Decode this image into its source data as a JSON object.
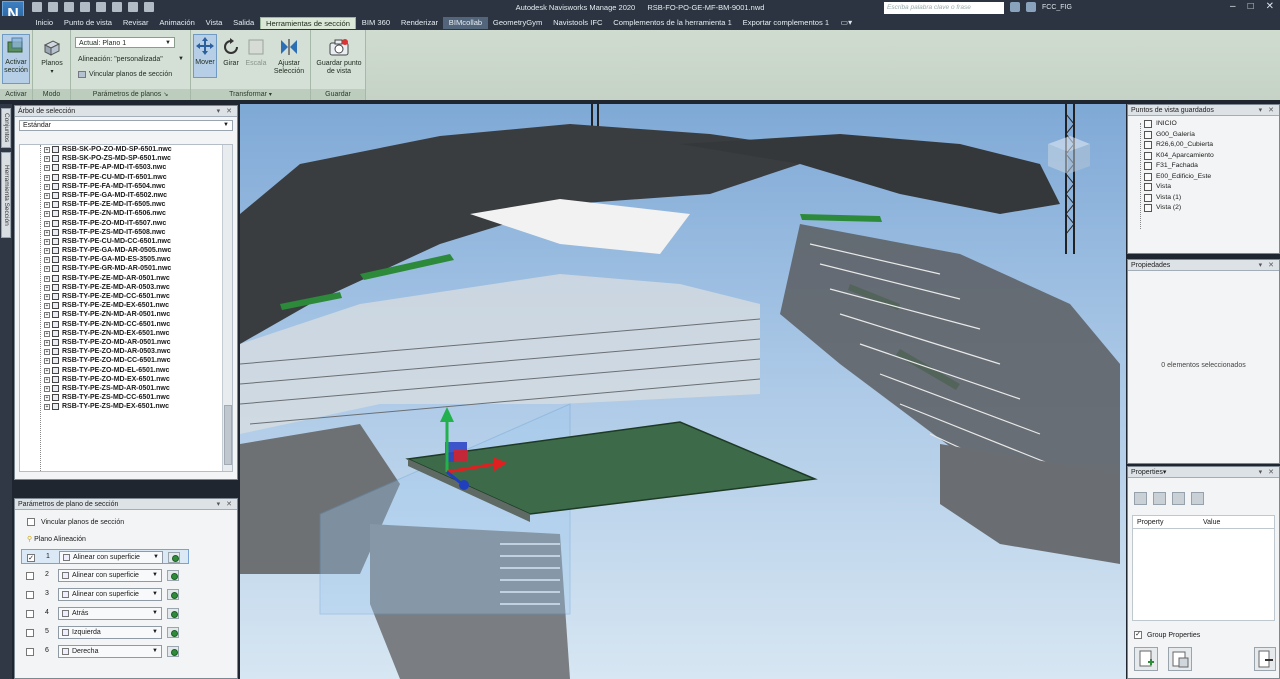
{
  "title": {
    "app": "Autodesk Navisworks Manage 2020",
    "file": "RSB-FO-PO-GE-MF-BM-9001.nwd",
    "search_placeholder": "Escriba palabra clave o frase",
    "user": "FCC_FIG"
  },
  "menu": {
    "tabs": [
      "Inicio",
      "Punto de vista",
      "Revisar",
      "Animación",
      "Vista",
      "Salida",
      "Herramientas de sección",
      "BIM 360",
      "Renderizar",
      "BIMcollab",
      "GeometryGym",
      "Navistools IFC",
      "Complementos de la herramienta 1",
      "Exportar complementos 1"
    ],
    "active_index": 6,
    "hover_index": 9
  },
  "ribbon": {
    "activar": {
      "button": "Activar sección",
      "label": "Activar"
    },
    "modo": {
      "button": "Planos",
      "label": "Modo"
    },
    "parametros": {
      "current_plane": "Actual: Plano 1",
      "alignment": "Alineación: \"personalizada\"",
      "link": "Vincular planos de sección",
      "label": "Parámetros de planos"
    },
    "transformar": {
      "mover": "Mover",
      "girar": "Girar",
      "escala": "Escala",
      "ajustar": "Ajustar Selección",
      "label": "Transformar"
    },
    "guardar": {
      "button": "Guardar punto de vista",
      "label": "Guardar"
    }
  },
  "side_tabs": [
    "Conjuntos",
    "Herramienta Sección"
  ],
  "selection_tree": {
    "title": "Árbol de selección",
    "mode": "Estándar",
    "items": [
      "RSB-SK-PO-ZO-MD-SP-6501.nwc",
      "RSB-SK-PO-ZS-MD-SP-6501.nwc",
      "RSB-TF-PE-AP-MD-IT-6503.nwc",
      "RSB-TF-PE-CU-MD-IT-6501.nwc",
      "RSB-TF-PE-FA-MD-IT-6504.nwc",
      "RSB-TF-PE-GA-MD-IT-6502.nwc",
      "RSB-TF-PE-ZE-MD-IT-6505.nwc",
      "RSB-TF-PE-ZN-MD-IT-6506.nwc",
      "RSB-TF-PE-ZO-MD-IT-6507.nwc",
      "RSB-TF-PE-ZS-MD-IT-6508.nwc",
      "RSB-TY-PE-CU-MD-CC-6501.nwc",
      "RSB-TY-PE-GA-MD-AR-0505.nwc",
      "RSB-TY-PE-GA-MD-ES-3505.nwc",
      "RSB-TY-PE-GR-MD-AR-0501.nwc",
      "RSB-TY-PE-ZE-MD-AR-0501.nwc",
      "RSB-TY-PE-ZE-MD-AR-0503.nwc",
      "RSB-TY-PE-ZE-MD-CC-6501.nwc",
      "RSB-TY-PE-ZE-MD-EX-6501.nwc",
      "RSB-TY-PE-ZN-MD-AR-0501.nwc",
      "RSB-TY-PE-ZN-MD-CC-6501.nwc",
      "RSB-TY-PE-ZN-MD-EX-6501.nwc",
      "RSB-TY-PE-ZO-MD-AR-0501.nwc",
      "RSB-TY-PE-ZO-MD-AR-0503.nwc",
      "RSB-TY-PE-ZO-MD-CC-6501.nwc",
      "RSB-TY-PE-ZO-MD-EL-6501.nwc",
      "RSB-TY-PE-ZO-MD-EX-6501.nwc",
      "RSB-TY-PE-ZS-MD-AR-0501.nwc",
      "RSB-TY-PE-ZS-MD-CC-6501.nwc",
      "RSB-TY-PE-ZS-MD-EX-6501.nwc"
    ]
  },
  "section_params": {
    "title": "Parámetros de plano de sección",
    "link_label": "Vincular planos de sección",
    "alignment_label": "Plano Alineación",
    "rows": [
      {
        "num": "1",
        "checked": true,
        "mode": "Alinear con superficie"
      },
      {
        "num": "2",
        "checked": false,
        "mode": "Alinear con superficie"
      },
      {
        "num": "3",
        "checked": false,
        "mode": "Alinear con superficie"
      },
      {
        "num": "4",
        "checked": false,
        "mode": "Atrás"
      },
      {
        "num": "5",
        "checked": false,
        "mode": "Izquierda"
      },
      {
        "num": "6",
        "checked": false,
        "mode": "Derecha"
      }
    ]
  },
  "saved_views": {
    "title": "Puntos de vista guardados",
    "items": [
      "INICIO",
      "G00_Galería",
      "R26,6,00_Cubierta",
      "K04_Aparcamiento",
      "F31_Fachada",
      "E00_Edificio_Este",
      "Vista",
      "Vista (1)",
      "Vista (2)"
    ]
  },
  "properties_es": {
    "title": "Propiedades",
    "empty": "0 elementos seleccionados"
  },
  "properties_en": {
    "title": "Properties",
    "col_property": "Property",
    "col_value": "Value",
    "group": "Group Properties"
  },
  "colors": {
    "section_plane": "#3d6b4a",
    "gizmo_x": "#e02020",
    "gizmo_y": "#22b14c",
    "gizmo_z": "#1f3fbf"
  }
}
